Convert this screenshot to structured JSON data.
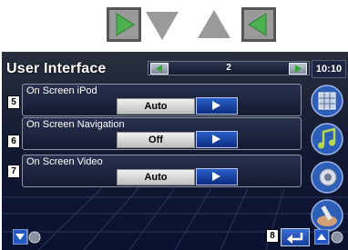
{
  "legend_buttons": [
    "green-right-arrow",
    "gray-down-triangle",
    "gray-up-triangle",
    "green-left-arrow"
  ],
  "screen": {
    "title": "User Interface",
    "page_number": "2",
    "clock": "10:10",
    "settings": [
      {
        "callout": "5",
        "label": "On Screen iPod",
        "value": "Auto"
      },
      {
        "callout": "6",
        "label": "On Screen Navigation",
        "value": "Off"
      },
      {
        "callout": "7",
        "label": "On Screen Video",
        "value": "Auto"
      }
    ],
    "return_callout": "8"
  },
  "colors": {
    "accent_green": "#49b04a",
    "button_blue": "#1d4fb5",
    "screen_bg": "#0d1430"
  }
}
